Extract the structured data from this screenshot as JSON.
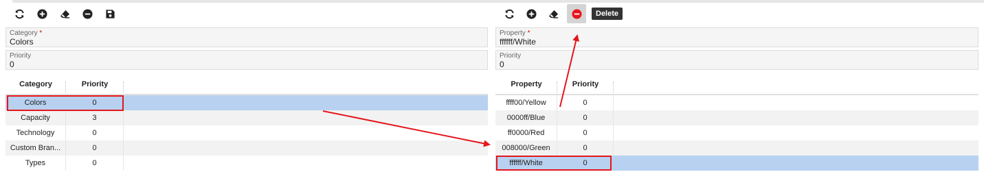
{
  "left": {
    "tooltip": "",
    "fields": [
      {
        "label": "Category",
        "required": "*",
        "value": "Colors"
      },
      {
        "label": "Priority",
        "required": "",
        "value": "0"
      }
    ],
    "columns": [
      "Category",
      "Priority"
    ],
    "rows": [
      [
        "Colors",
        "0"
      ],
      [
        "Capacity",
        "3"
      ],
      [
        "Technology",
        "0"
      ],
      [
        "Custom Bran...",
        "0"
      ],
      [
        "Types",
        "0"
      ]
    ]
  },
  "right": {
    "tooltip": "Delete",
    "fields": [
      {
        "label": "Property",
        "required": "*",
        "value": "ffffff/White"
      },
      {
        "label": "Priority",
        "required": "",
        "value": "0"
      }
    ],
    "columns": [
      "Property",
      "Priority"
    ],
    "rows": [
      [
        "ffff00/Yellow",
        "0"
      ],
      [
        "0000ff/Blue",
        "0"
      ],
      [
        "ff0000/Red",
        "0"
      ],
      [
        "008000/Green",
        "0"
      ],
      [
        "ffffff/White",
        "0"
      ]
    ]
  },
  "colors": {
    "selection": "#b8d1f0",
    "annotation": "#e4161b",
    "delete_active": "#e8141c"
  },
  "icons": [
    "refresh-icon",
    "add-icon",
    "eraser-icon",
    "remove-icon",
    "save-icon"
  ]
}
